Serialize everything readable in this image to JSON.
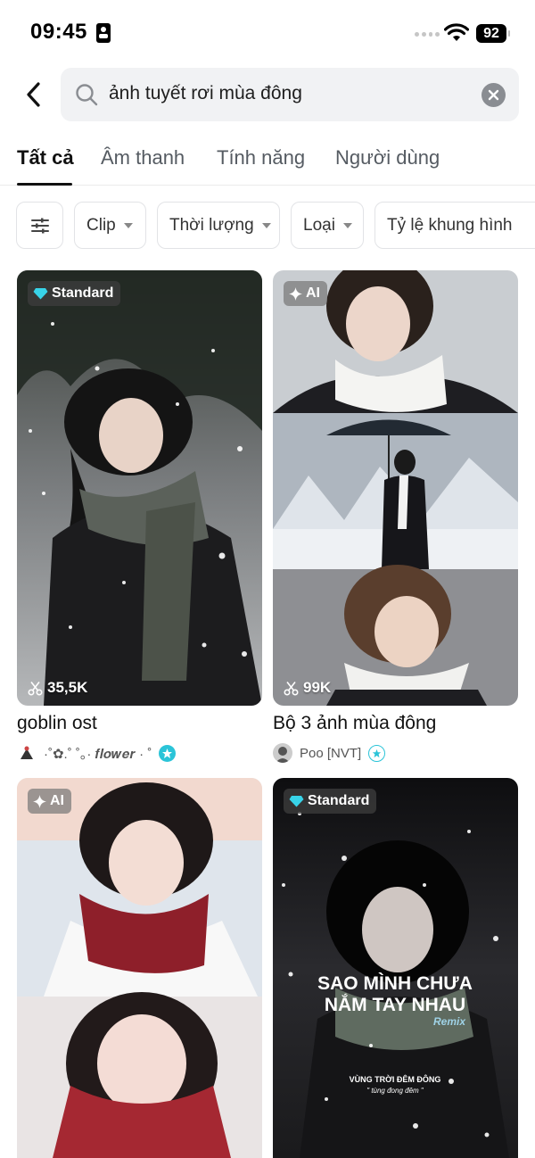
{
  "status_bar": {
    "time": "09:45",
    "battery": "92"
  },
  "search": {
    "query": "ảnh tuyết rơi mùa đông"
  },
  "tabs": [
    {
      "label": "Tất cả"
    },
    {
      "label": "Âm thanh"
    },
    {
      "label": "Tính năng"
    },
    {
      "label": "Người dùng"
    }
  ],
  "filters": [
    {
      "label": "Clip"
    },
    {
      "label": "Thời lượng"
    },
    {
      "label": "Loại"
    },
    {
      "label": "Tỷ lệ khung hình"
    }
  ],
  "cards": [
    {
      "badge": "Standard",
      "uses": "35,5K",
      "title": "goblin ost",
      "author": "·˚✿.˚ ˚。· 𝒇𝒍𝒐𝒘𝒆𝒓 · ˚"
    },
    {
      "badge": "AI",
      "uses": "99K",
      "title": "Bộ 3 ảnh mùa đông",
      "author": "Poo [NVT]"
    },
    {
      "badge": "AI"
    },
    {
      "badge": "Standard",
      "overlay_title_1": "SAO MÌNH CHƯA",
      "overlay_title_2": "NẮM TAY NHAU",
      "overlay_remix": "Remix",
      "overlay_sub_1": "VÙNG TRỜI ĐÊM ĐÔNG",
      "overlay_sub_2": "\" tùng đong đêm \""
    }
  ],
  "colors": {
    "accent_teal": "#2bc4d8",
    "text_primary": "#111111",
    "chip_border": "#e2e3e6"
  }
}
